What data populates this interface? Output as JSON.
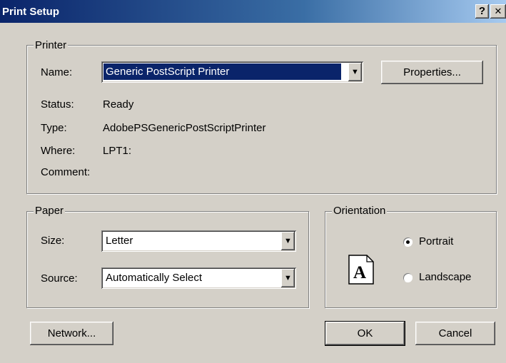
{
  "window": {
    "title": "Print Setup",
    "help_glyph": "?",
    "close_glyph": "✕"
  },
  "printer": {
    "legend": "Printer",
    "name_label": "Name:",
    "name_value": "Generic PostScript Printer",
    "properties_button": "Properties...",
    "status_label": "Status:",
    "status_value": "Ready",
    "type_label": "Type:",
    "type_value": "AdobePSGenericPostScriptPrinter",
    "where_label": "Where:",
    "where_value": "LPT1:",
    "comment_label": "Comment:",
    "comment_value": ""
  },
  "paper": {
    "legend": "Paper",
    "size_label": "Size:",
    "size_value": "Letter",
    "source_label": "Source:",
    "source_value": "Automatically Select"
  },
  "orientation": {
    "legend": "Orientation",
    "preview_glyph": "A",
    "portrait_label": "Portrait",
    "landscape_label": "Landscape",
    "selected": "Portrait"
  },
  "buttons": {
    "network": "Network...",
    "ok": "OK",
    "cancel": "Cancel"
  },
  "icons": {
    "dropdown_arrow": "▼",
    "help": "question-icon",
    "close": "close-icon",
    "page_preview": "page-portrait-icon"
  }
}
